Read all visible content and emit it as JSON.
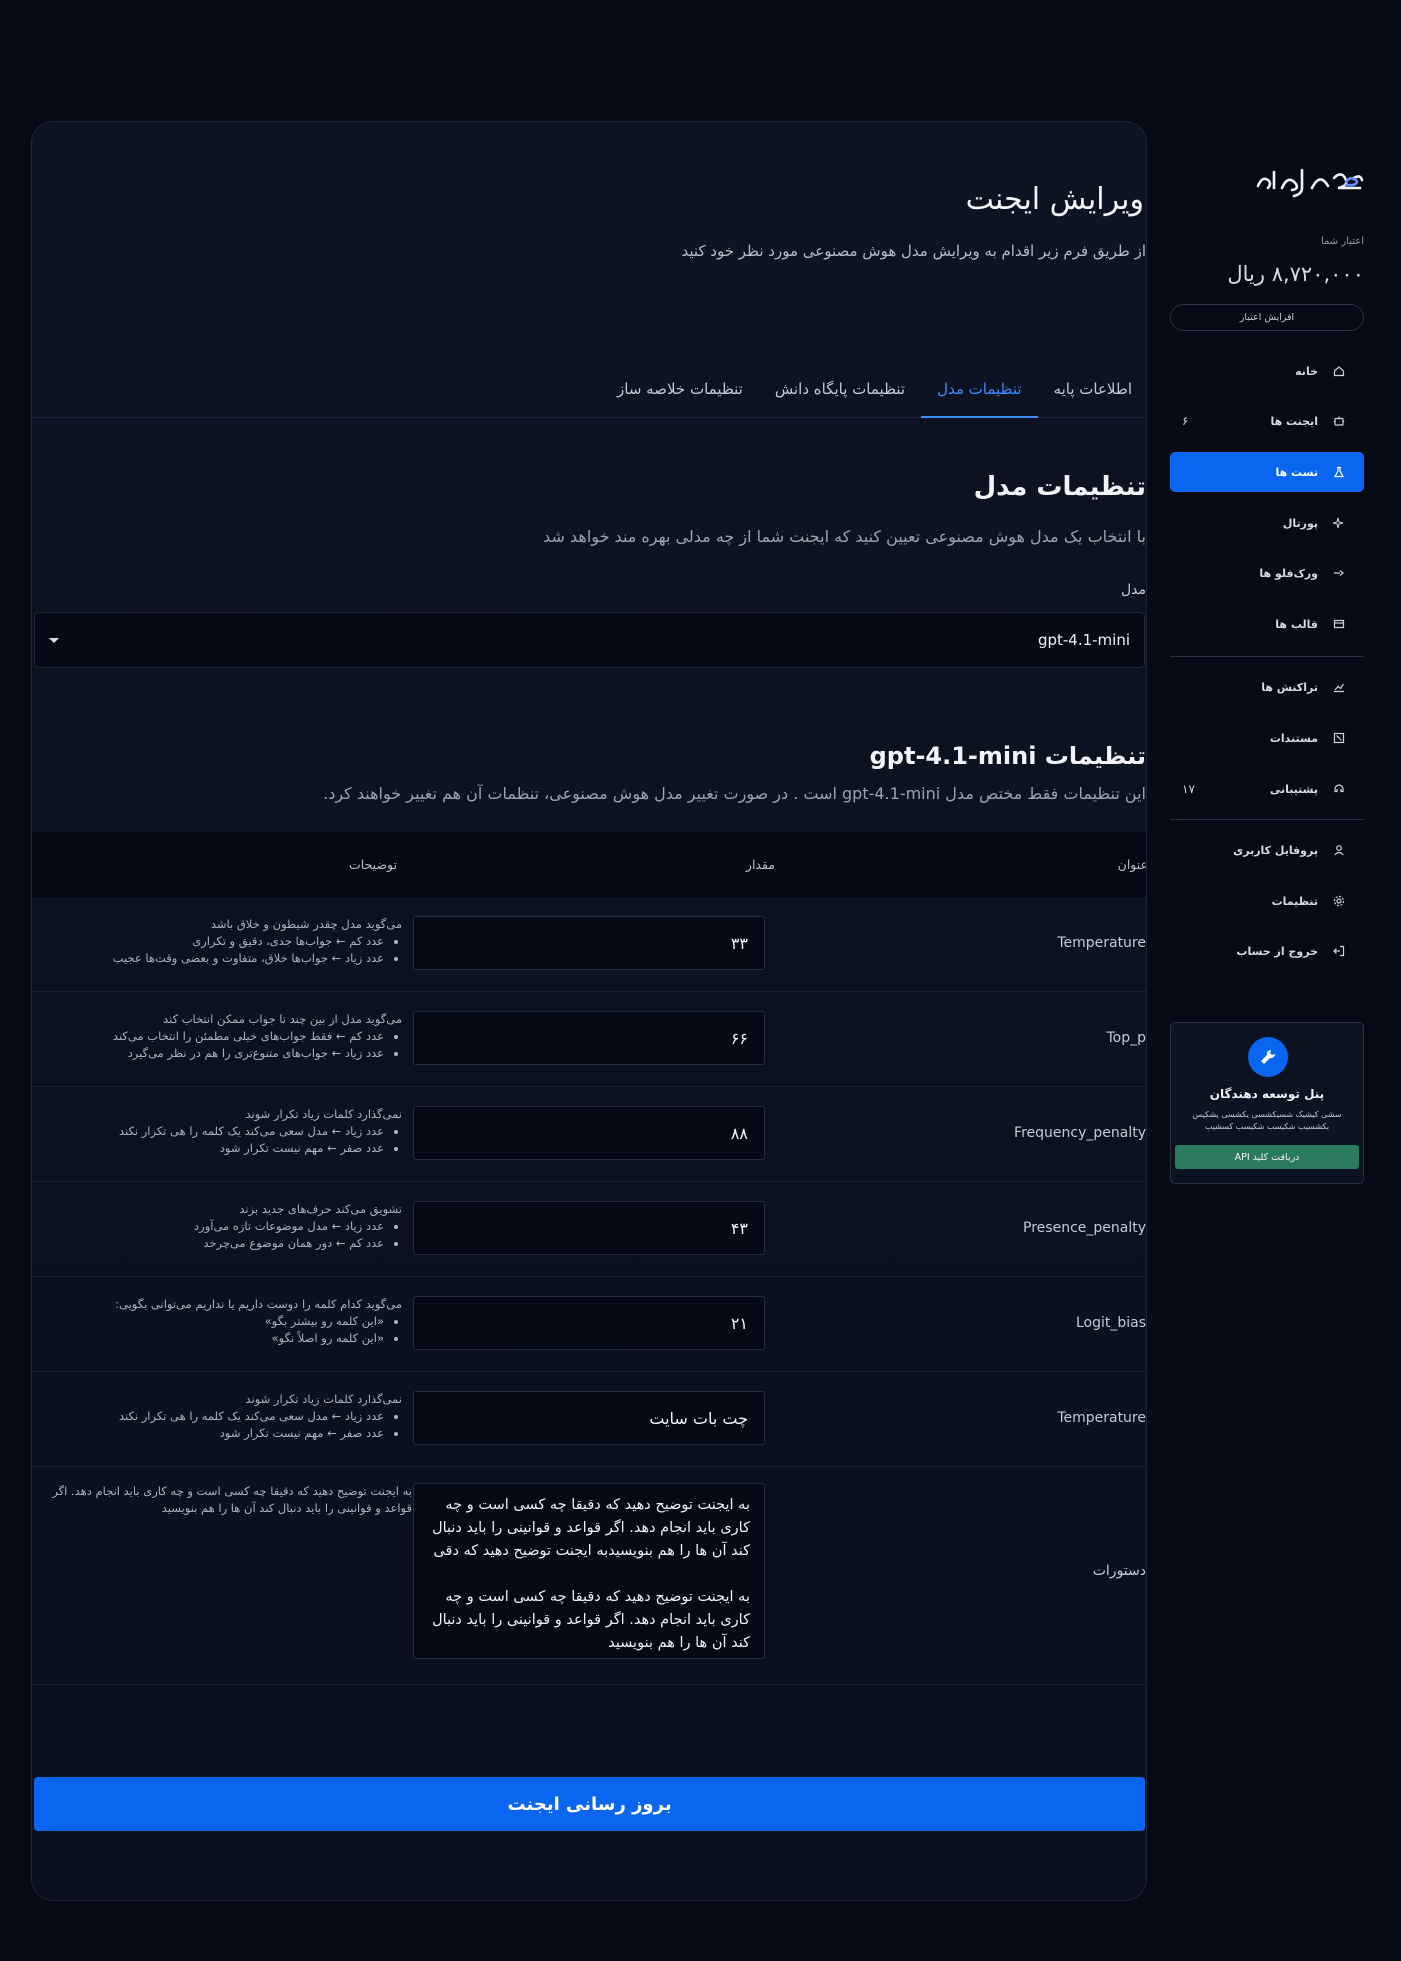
{
  "page": {
    "title": "ویرایش ایجنت",
    "subtitle": "از طریق فرم زیر اقدام به ویرایش مدل هوش مصنوعی مورد نظر خود کنید"
  },
  "tabs": [
    {
      "label": "اطلاعات پایه",
      "active": false
    },
    {
      "label": "تنظیمات مدل",
      "active": true
    },
    {
      "label": "تنظیمات پایگاه دانش",
      "active": false
    },
    {
      "label": "تنظیمات خلاصه ساز",
      "active": false
    }
  ],
  "model_section": {
    "title": "تنظیمات مدل",
    "description": "با انتخاب یک مدل هوش مصنوعی تعیین کنید که ایجنت شما از چه مدلی بهره مند خواهد شد",
    "field_label": "مدل",
    "selected_model": "gpt-4.1-mini"
  },
  "params_section": {
    "title": "تنظیمات gpt-4.1-mini",
    "description": "این تنظیمات فقط مختص مدل gpt-4.1-mini است . در صورت تغییر مدل هوش مصنوعی، تنظمات آن هم تغییر خواهند کرد."
  },
  "table": {
    "headers": {
      "title": "عنوان",
      "value": "مقدار",
      "desc": "توضیحات"
    },
    "rows": [
      {
        "title": "Temperature",
        "value": "۳۳",
        "desc_intro": "می‌گوید مدل چقدر شیطون و خلاق باشد",
        "bullets": [
          "عدد کم ← جواب‌ها جدی، دقیق و تکراری",
          "عدد زیاد ← جواب‌ها خلاق، متفاوت و بعضی وقت‌ها عجیب"
        ]
      },
      {
        "title": "Top_p",
        "value": "۶۶",
        "desc_intro": "می‌گوید مدل از بین چند تا جواب ممکن انتخاب کند",
        "bullets": [
          "عدد کم ← فقط جواب‌های خیلی مطمئن را انتخاب می‌کند",
          "عدد زیاد ← جواب‌های متنوع‌تری را هم در نظر می‌گیرد"
        ]
      },
      {
        "title": "Frequency_penalty",
        "value": "۸۸",
        "desc_intro": "نمی‌گذارد کلمات زیاد تکرار شوند",
        "bullets": [
          "عدد زیاد ← مدل سعی می‌کند یک کلمه را هی تکرار نکند",
          "عدد صفر ← مهم نیست تکرار شود"
        ]
      },
      {
        "title": "Presence_penalty",
        "value": "۴۳",
        "desc_intro": "تشویق می‌کند حرف‌های جدید بزند",
        "bullets": [
          "عدد زیاد ← مدل موضوعات تازه می‌آورد",
          "عدد کم ← دور همان موضوع می‌چرخد"
        ]
      },
      {
        "title": "Logit_bias",
        "value": "۲۱",
        "desc_intro": "می‌گوید کدام کلمه را دوست داریم یا نداریم می‌توانی بگویی:",
        "bullets": [
          "«این کلمه رو بیشتر بگو»",
          "«این کلمه رو اصلاً نگو»"
        ]
      },
      {
        "title": "Temperature",
        "value": "چت بات سایت",
        "desc_intro": "نمی‌گذارد کلمات زیاد تکرار شوند",
        "bullets": [
          "عدد زیاد ← مدل سعی می‌کند یک کلمه را هی تکرار نکند",
          "عدد صفر ← مهم نیست تکرار شود"
        ]
      }
    ],
    "instructions_row": {
      "title": "دستورات",
      "desc": "به ایجنت توضیح دهید که دقیقا چه کسی است و چه کاری باید انجام دهد. اگر قواعد و قوانینی را باید دنبال کند آن ها را  هم بنویسید",
      "value_p1": "به ایجنت توضیح دهید که دقیقا چه کسی است و چه کاری باید انجام دهد. اگر قواعد و قوانینی را باید دنبال کند آن ها را  هم بنویسیدبه ایجنت توضیح دهید که دقی",
      "value_p2": "به ایجنت توضیح دهید که دقیقا چه کسی است و چه کاری باید انجام دهد. اگر قواعد و قوانینی را باید دنبال کند آن ها را  هم بنویسید"
    }
  },
  "submit_label": "بروز رسانی ایجنت",
  "sidebar": {
    "credit_label": "اعتبار شما",
    "credit_amount": "۸,۷۲۰,۰۰۰ ریال",
    "credit_button": "افزایش اعتبار",
    "items": [
      {
        "label": "خانه",
        "icon": "home-icon",
        "count": ""
      },
      {
        "label": "ایجنت ها",
        "icon": "robot-icon",
        "count": "۶"
      },
      {
        "label": "تست ها",
        "icon": "flask-icon",
        "count": ""
      },
      {
        "label": "پورتال",
        "icon": "sparkles-icon",
        "count": ""
      },
      {
        "label": "ورک‌فلو ها",
        "icon": "workflow-icon",
        "count": ""
      },
      {
        "label": "قالب ها",
        "icon": "template-icon",
        "count": ""
      },
      {
        "label": "تراکنش ها",
        "icon": "chart-icon",
        "count": ""
      },
      {
        "label": "مستندات",
        "icon": "document-icon",
        "count": ""
      },
      {
        "label": "پشتیبانی",
        "icon": "support-icon",
        "count": "۱۷"
      },
      {
        "label": "پروفایل کاربری",
        "icon": "user-icon",
        "count": ""
      },
      {
        "label": "تنظیمات",
        "icon": "gear-icon",
        "count": ""
      },
      {
        "label": "خروج از حساب",
        "icon": "logout-icon",
        "count": ""
      }
    ],
    "dev_panel": {
      "title": "پنل توسعه دهندگان",
      "text": "سشی کیشیک شسیکشسی یکشسی یشکیس یکشسیب شکیسب شکیسب کسشیب",
      "button": "دریافت کلید API"
    }
  },
  "colors": {
    "accent": "#0a66f0",
    "background": "#050a14",
    "dev_button": "#2a7a5e"
  }
}
